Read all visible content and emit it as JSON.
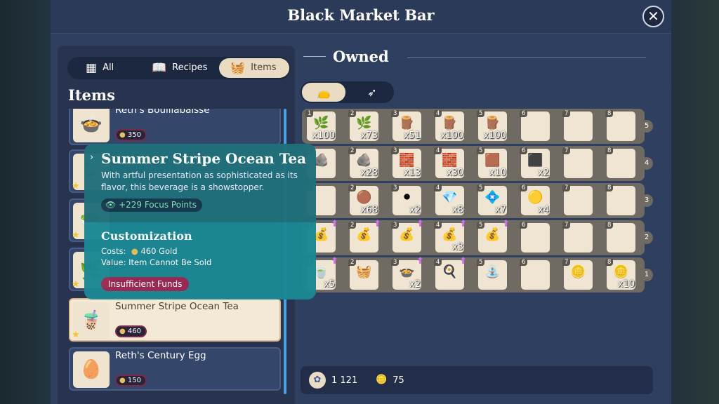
{
  "window": {
    "title": "Black Market Bar",
    "close_icon": "close-icon"
  },
  "tabs": [
    {
      "label": "All",
      "icon": "grid-icon"
    },
    {
      "label": "Recipes",
      "icon": "book-icon"
    },
    {
      "label": "Items",
      "icon": "basket-icon",
      "active": true
    }
  ],
  "list": {
    "heading": "Items",
    "items": [
      {
        "name": "Reth's Bouillabaisse",
        "price": "350",
        "starred": false,
        "icon": "🍲"
      },
      {
        "name": "",
        "price": "",
        "starred": true,
        "icon": "🍹"
      },
      {
        "name": "",
        "price": "",
        "starred": true,
        "icon": "🥗"
      },
      {
        "name": "",
        "price": "",
        "starred": true,
        "icon": "🌿"
      },
      {
        "name": "Summer Stripe Ocean Tea",
        "price": "460",
        "starred": true,
        "selected": true,
        "icon": "🧋"
      },
      {
        "name": "Reth's Century Egg",
        "price": "150",
        "starred": false,
        "icon": "🥚"
      }
    ]
  },
  "tooltip": {
    "title": "Summer Stripe Ocean Tea",
    "description": "With artful presentation as sophisticated as its flavor, this beverage is a showstopper.",
    "focus": "+229 Focus Points",
    "section": "Customization",
    "costs_label": "Costs:",
    "costs_value": "460 Gold",
    "value_label": "Value:",
    "value_value": "Item Cannot Be Sold",
    "status": "Insufficient Funds"
  },
  "owned": {
    "heading": "Owned",
    "filters": [
      {
        "icon": "bag-icon",
        "active": true
      },
      {
        "icon": "feather-icon",
        "active": false
      }
    ]
  },
  "inventory": {
    "rows": [
      {
        "label": "5",
        "slots": [
          {
            "n": "1",
            "c": "x100",
            "i": "🌿"
          },
          {
            "n": "2",
            "c": "x73",
            "i": "🌿"
          },
          {
            "n": "3",
            "c": "x51",
            "i": "🪵"
          },
          {
            "n": "4",
            "c": "x100",
            "i": "🪵"
          },
          {
            "n": "5",
            "c": "x100",
            "i": "🪵"
          },
          {
            "n": "6"
          },
          {
            "n": "7"
          },
          {
            "n": "8"
          }
        ]
      },
      {
        "label": "4",
        "slots": [
          {
            "n": "1",
            "i": "🪨"
          },
          {
            "n": "2",
            "c": "x28",
            "i": "🪨"
          },
          {
            "n": "3",
            "c": "x13",
            "i": "🧱"
          },
          {
            "n": "4",
            "c": "x30",
            "i": "🧱"
          },
          {
            "n": "5",
            "c": "x10",
            "i": "🟫"
          },
          {
            "n": "6",
            "c": "x2",
            "i": "⬛"
          },
          {
            "n": "7"
          },
          {
            "n": "8"
          }
        ]
      },
      {
        "label": "3",
        "slots": [
          {
            "n": "1"
          },
          {
            "n": "2",
            "c": "x68",
            "i": "🟤"
          },
          {
            "n": "3",
            "c": "x2",
            "i": "⚫"
          },
          {
            "n": "4",
            "c": "x8",
            "i": "💎"
          },
          {
            "n": "5",
            "c": "x7",
            "i": "💠"
          },
          {
            "n": "6",
            "c": "x4",
            "i": "🟡"
          },
          {
            "n": "7"
          },
          {
            "n": "8"
          }
        ]
      },
      {
        "label": "2",
        "slots": [
          {
            "n": "1",
            "i": "💰",
            "up": true
          },
          {
            "n": "2",
            "i": "💰",
            "up": true
          },
          {
            "n": "3",
            "i": "💰",
            "up": true
          },
          {
            "n": "4",
            "c": "x3",
            "i": "💰",
            "up": true
          },
          {
            "n": "5",
            "i": "💰",
            "up": true
          },
          {
            "n": "6"
          },
          {
            "n": "7"
          },
          {
            "n": "8"
          }
        ]
      },
      {
        "label": "1",
        "slots": [
          {
            "n": "1",
            "c": "x5",
            "i": "🍵",
            "up": true
          },
          {
            "n": "2",
            "i": "🧺"
          },
          {
            "n": "3",
            "c": "x2",
            "i": "🍲",
            "up": true
          },
          {
            "n": "4",
            "i": "🍳",
            "up": true
          },
          {
            "n": "5",
            "i": "⛲"
          },
          {
            "n": "6"
          },
          {
            "n": "7",
            "i": "🪙"
          },
          {
            "n": "8",
            "c": "x10",
            "i": "🪙"
          }
        ]
      }
    ]
  },
  "currency": {
    "blue": "1 121",
    "gold": "75"
  },
  "colors": {
    "panel": "#2f3f5f",
    "tooltip": "#20707b",
    "warning": "#9a2a52",
    "accent": "#4aa0e2"
  }
}
